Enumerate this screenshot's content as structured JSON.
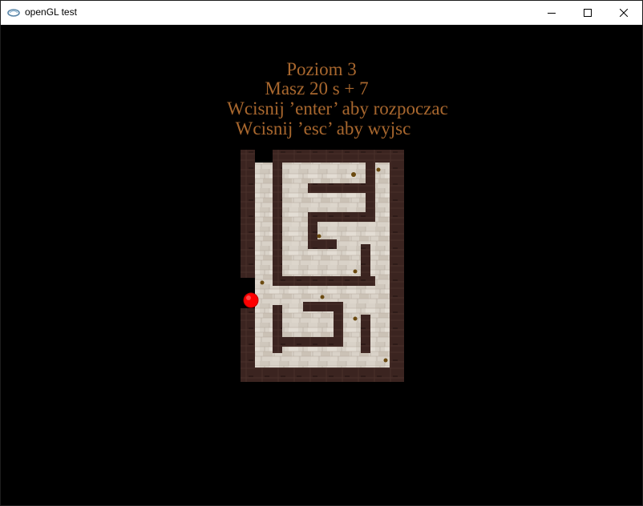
{
  "window": {
    "title": "openGL test",
    "icon": "opengl-app-icon",
    "controls": [
      "minimize-icon",
      "maximize-icon",
      "close-icon"
    ]
  },
  "game": {
    "messages": [
      "Poziom 3",
      "Masz 20 s + 7",
      "Wcisnij ’enter’ aby rozpoczac",
      "Wcisnij ’esc’ aby wyjsc"
    ],
    "colors": {
      "text": "#a8672e",
      "wall": "#3b2420",
      "floor": "#d9d2c8",
      "ball": "#ff0000",
      "coin": "#6b4a10"
    },
    "player": {
      "icon": "red-ball-icon"
    },
    "collectibles": {
      "icon": "coin-dot-icon"
    }
  }
}
